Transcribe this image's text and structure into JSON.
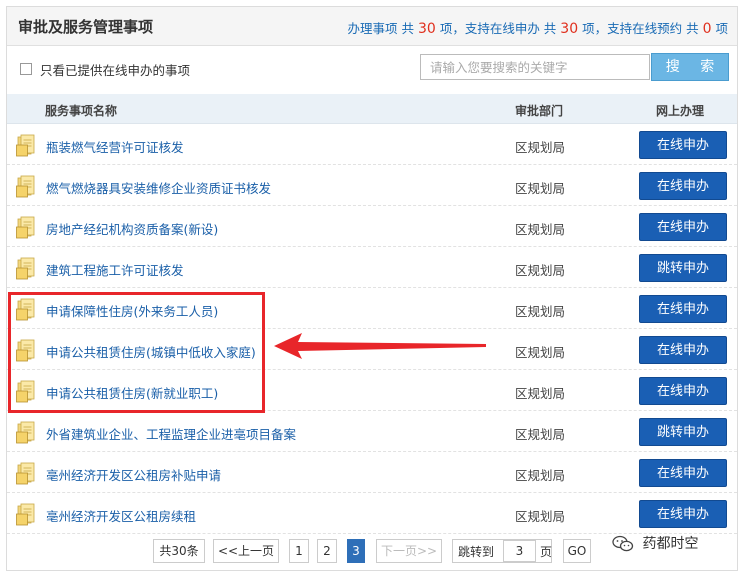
{
  "header": {
    "title": "审批及服务管理事项",
    "stats_prefix": "办理事项 共",
    "total_items": "30",
    "stats_mid1": "项，支持在线申办 共",
    "online_items": "30",
    "stats_mid2": "项，支持在线预约 共",
    "booking_items": "0",
    "stats_suffix": "项"
  },
  "filter": {
    "checkbox_label": "只看已提供在线申办的事项",
    "search_placeholder": "请输入您要搜索的关键字",
    "search_button": "搜 索"
  },
  "table": {
    "headers": [
      "服务事项名称",
      "审批部门",
      "网上办理"
    ],
    "rows": [
      {
        "name": "瓶装燃气经营许可证核发",
        "dept": "区规划局",
        "action": "在线申办"
      },
      {
        "name": "燃气燃烧器具安装维修企业资质证书核发",
        "dept": "区规划局",
        "action": "在线申办"
      },
      {
        "name": "房地产经纪机构资质备案(新设)",
        "dept": "区规划局",
        "action": "在线申办"
      },
      {
        "name": "建筑工程施工许可证核发",
        "dept": "区规划局",
        "action": "跳转申办"
      },
      {
        "name": "申请保障性住房(外来务工人员)",
        "dept": "区规划局",
        "action": "在线申办"
      },
      {
        "name": "申请公共租赁住房(城镇中低收入家庭)",
        "dept": "区规划局",
        "action": "在线申办"
      },
      {
        "name": "申请公共租赁住房(新就业职工)",
        "dept": "区规划局",
        "action": "在线申办"
      },
      {
        "name": "外省建筑业企业、工程监理企业进亳项目备案",
        "dept": "区规划局",
        "action": "跳转申办"
      },
      {
        "name": "亳州经济开发区公租房补贴申请",
        "dept": "区规划局",
        "action": "在线申办"
      },
      {
        "name": "亳州经济开发区公租房续租",
        "dept": "区规划局",
        "action": "在线申办"
      }
    ]
  },
  "pager": {
    "total": "共30条",
    "prev": "<<上一页",
    "pages": [
      "1",
      "2",
      "3"
    ],
    "current_page": "3",
    "next": "下一页>>",
    "jump_label": "跳转到",
    "jump_value": "3",
    "page_unit": "页",
    "go": "GO"
  },
  "watermark": {
    "text": "药都时空"
  },
  "colors": {
    "button_blue": "#1a5fb4",
    "link_blue": "#1a5fa8",
    "highlight_red": "#e8262a",
    "stats_red": "#e0301e"
  },
  "icons": {
    "row_icon": "folder-document-icon",
    "watermark_icon": "wechat-icon"
  }
}
